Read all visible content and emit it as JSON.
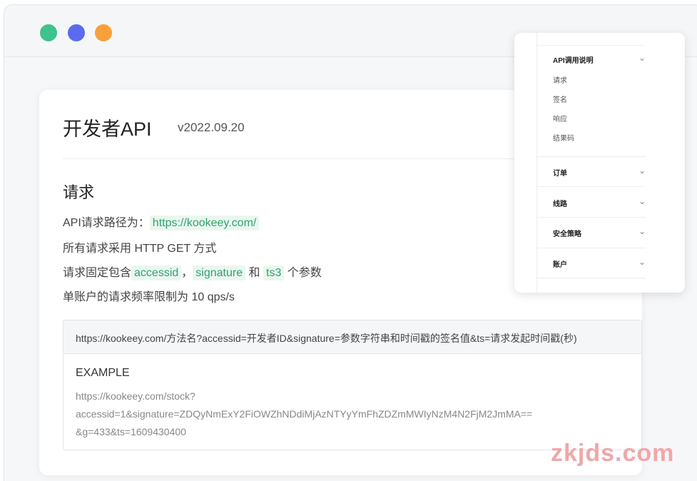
{
  "window": {
    "controls": [
      "close",
      "minimize",
      "maximize"
    ]
  },
  "card": {
    "title": "开发者API",
    "version": "v2022.09.20",
    "section_title": "请求",
    "line1_prefix": "API请求路径为：",
    "line1_link": "https://kookeey.com/",
    "line2": "所有请求采用 HTTP GET 方式",
    "line3_prefix": "请求固定包含",
    "line3_code1": "accessid",
    "line3_sep": "，",
    "line3_code2": "signature",
    "line3_mid": " 和 ",
    "line3_code3": "ts3",
    "line3_suffix": " 个参数",
    "line4": "单账户的请求频率限制为 10 qps/s",
    "code_url": "https://kookeey.com/方法名?accessid=开发者ID&signature=参数字符串和时间戳的签名值&ts=请求发起时间戳(秒)",
    "example_title": "EXAMPLE",
    "example_lines": [
      "https://kookeey.com/stock?",
      "accessid=1&signature=ZDQyNmExY2FiOWZhNDdiMjAzNTYyYmFhZDZmMWIyNzM4N2FjM2JmMA==",
      "&g=433&ts=1609430400"
    ]
  },
  "nav": {
    "groups": [
      {
        "label": "API调用说明",
        "items": [
          "请求",
          "签名",
          "响应",
          "结果码"
        ]
      },
      {
        "label": "订单",
        "items": []
      },
      {
        "label": "线路",
        "items": []
      },
      {
        "label": "安全策略",
        "items": []
      },
      {
        "label": "账户",
        "items": []
      }
    ],
    "chevron": "⌄"
  },
  "watermark": "zkjds.com",
  "colors": {
    "dot_green": "#3ec28f",
    "dot_blue": "#5b6af0",
    "dot_orange": "#f8a03b",
    "highlight": "#2fa36b"
  }
}
